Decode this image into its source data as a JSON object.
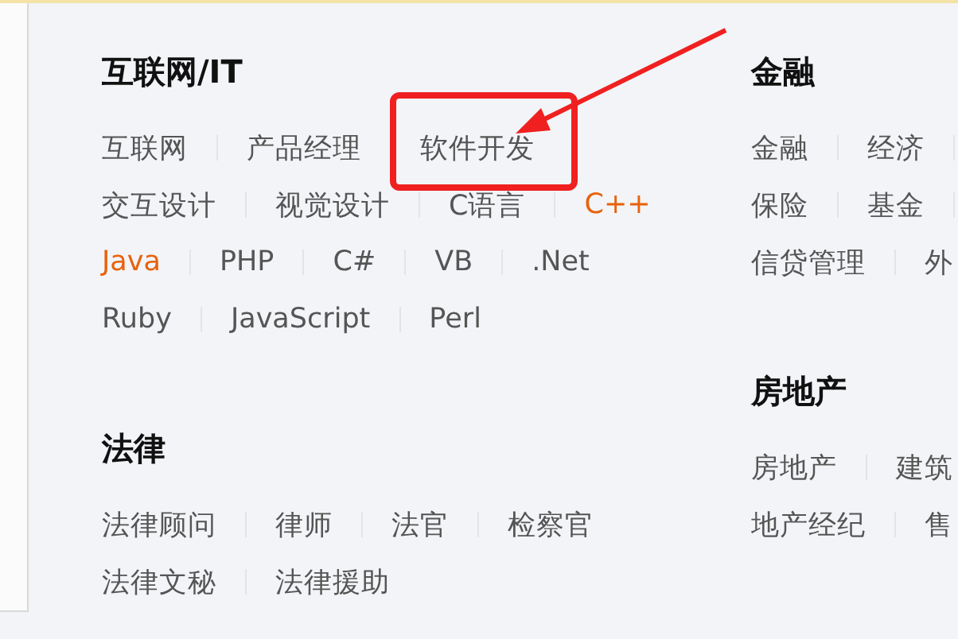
{
  "columns": [
    {
      "sections": [
        {
          "title": "互联网/IT",
          "lines": [
            {
              "links": [
                {
                  "label": "互联网",
                  "hot": false
                },
                {
                  "label": "产品经理",
                  "hot": false
                },
                {
                  "label": "软件开发",
                  "hot": false
                }
              ]
            },
            {
              "links": [
                {
                  "label": "交互设计",
                  "hot": false
                },
                {
                  "label": "视觉设计",
                  "hot": false
                },
                {
                  "label": "C语言",
                  "hot": false
                },
                {
                  "label": "C++",
                  "hot": true
                }
              ]
            },
            {
              "links": [
                {
                  "label": "Java",
                  "hot": true
                },
                {
                  "label": "PHP",
                  "hot": false
                },
                {
                  "label": "C#",
                  "hot": false
                },
                {
                  "label": "VB",
                  "hot": false
                },
                {
                  "label": ".Net",
                  "hot": false
                }
              ]
            },
            {
              "links": [
                {
                  "label": "Ruby",
                  "hot": false
                },
                {
                  "label": "JavaScript",
                  "hot": false
                },
                {
                  "label": "Perl",
                  "hot": false
                }
              ]
            }
          ]
        },
        {
          "title": "法律",
          "lines": [
            {
              "links": [
                {
                  "label": "法律顾问",
                  "hot": false
                },
                {
                  "label": "律师",
                  "hot": false
                },
                {
                  "label": "法官",
                  "hot": false
                },
                {
                  "label": "检察官",
                  "hot": false
                }
              ]
            },
            {
              "links": [
                {
                  "label": "法律文秘",
                  "hot": false
                },
                {
                  "label": "法律援助",
                  "hot": false
                }
              ]
            }
          ]
        }
      ]
    },
    {
      "sections": [
        {
          "title": "金融",
          "lines": [
            {
              "trailing_divider": true,
              "links": [
                {
                  "label": "金融",
                  "hot": false
                },
                {
                  "label": "经济",
                  "hot": false
                }
              ]
            },
            {
              "trailing_divider": true,
              "links": [
                {
                  "label": "保险",
                  "hot": false
                },
                {
                  "label": "基金",
                  "hot": false
                }
              ]
            },
            {
              "links": [
                {
                  "label": "信贷管理",
                  "hot": false
                },
                {
                  "label": "外",
                  "hot": false
                }
              ]
            }
          ]
        },
        {
          "title": "房地产",
          "lines": [
            {
              "links": [
                {
                  "label": "房地产",
                  "hot": false
                },
                {
                  "label": "建筑",
                  "hot": false
                }
              ]
            },
            {
              "links": [
                {
                  "label": "地产经纪",
                  "hot": false
                },
                {
                  "label": "售",
                  "hot": false
                }
              ]
            }
          ]
        }
      ]
    }
  ]
}
